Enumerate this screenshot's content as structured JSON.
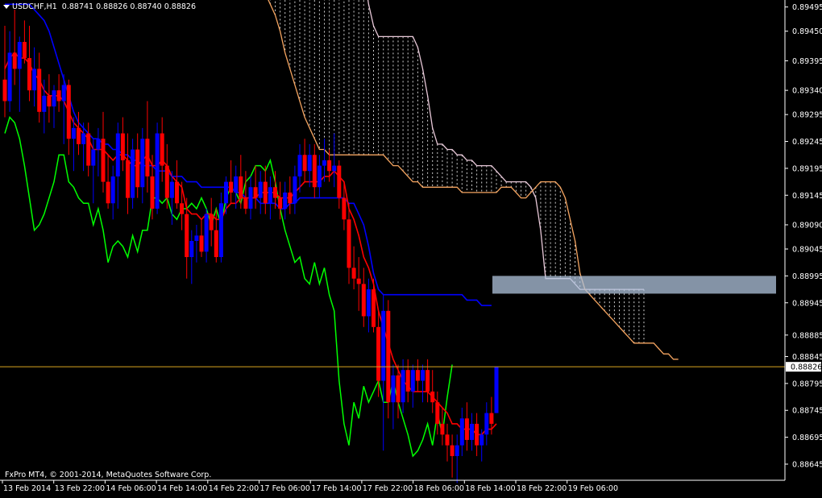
{
  "header": {
    "symbol_timeframe": "USDCHF,H1",
    "ohlc": "0.88741 0.88826 0.88740 0.88826"
  },
  "copyright": "FxPro MT4, © 2001-2014, MetaQuotes Software Corp.",
  "colors": {
    "background": "#000000",
    "bull_candle": "#0000FF",
    "bear_candle": "#FF0000",
    "tenkan": "#FF0000",
    "kijun": "#0000FF",
    "chikou": "#00FF00",
    "senkou_a": "#F4A460",
    "senkou_b": "#E8C8D8",
    "price_line": "#DAA520",
    "zone": "#B0C4DE"
  },
  "chart_data": {
    "type": "candlestick",
    "symbol": "USDCHF",
    "timeframe": "H1",
    "indicator": "Ichimoku Kinko Hyo",
    "last_price": "0.88826",
    "ylim": [
      0.88615,
      0.89505
    ],
    "y_ticks": [
      "0.89495",
      "0.89450",
      "0.89395",
      "0.89340",
      "0.89295",
      "0.89245",
      "0.89195",
      "0.89145",
      "0.89090",
      "0.89045",
      "0.88995",
      "0.88945",
      "0.88885",
      "0.88845",
      "0.88795",
      "0.88745",
      "0.88695",
      "0.88645"
    ],
    "x_labels": [
      "13 Feb 2014",
      "13 Feb 22:00",
      "14 Feb 06:00",
      "14 Feb 14:00",
      "14 Feb 22:00",
      "17 Feb 06:00",
      "17 Feb 14:00",
      "17 Feb 22:00",
      "18 Feb 06:00",
      "18 Feb 14:00",
      "18 Feb 22:00",
      "19 Feb 06:00"
    ],
    "candles": [
      {
        "o": 0.8936,
        "h": 0.8946,
        "l": 0.8929,
        "c": 0.8932
      },
      {
        "o": 0.8932,
        "h": 0.8945,
        "l": 0.893,
        "c": 0.8941
      },
      {
        "o": 0.8941,
        "h": 0.8949,
        "l": 0.8935,
        "c": 0.8938
      },
      {
        "o": 0.8938,
        "h": 0.8944,
        "l": 0.893,
        "c": 0.8943
      },
      {
        "o": 0.8943,
        "h": 0.8947,
        "l": 0.8939,
        "c": 0.894
      },
      {
        "o": 0.894,
        "h": 0.8946,
        "l": 0.8932,
        "c": 0.8934
      },
      {
        "o": 0.8934,
        "h": 0.8942,
        "l": 0.8931,
        "c": 0.8938
      },
      {
        "o": 0.8938,
        "h": 0.8941,
        "l": 0.8928,
        "c": 0.893
      },
      {
        "o": 0.893,
        "h": 0.8936,
        "l": 0.8926,
        "c": 0.8933
      },
      {
        "o": 0.8933,
        "h": 0.8937,
        "l": 0.8928,
        "c": 0.8931
      },
      {
        "o": 0.8931,
        "h": 0.8935,
        "l": 0.8927,
        "c": 0.8934
      },
      {
        "o": 0.8934,
        "h": 0.8937,
        "l": 0.893,
        "c": 0.8932
      },
      {
        "o": 0.8932,
        "h": 0.8937,
        "l": 0.8924,
        "c": 0.8935
      },
      {
        "o": 0.8935,
        "h": 0.8936,
        "l": 0.8922,
        "c": 0.8925
      },
      {
        "o": 0.8925,
        "h": 0.8929,
        "l": 0.8919,
        "c": 0.8927
      },
      {
        "o": 0.8927,
        "h": 0.893,
        "l": 0.8922,
        "c": 0.8924
      },
      {
        "o": 0.8924,
        "h": 0.8928,
        "l": 0.8919,
        "c": 0.8926
      },
      {
        "o": 0.8926,
        "h": 0.8928,
        "l": 0.8918,
        "c": 0.892
      },
      {
        "o": 0.892,
        "h": 0.8925,
        "l": 0.8913,
        "c": 0.8923
      },
      {
        "o": 0.8923,
        "h": 0.8927,
        "l": 0.8918,
        "c": 0.8925
      },
      {
        "o": 0.8925,
        "h": 0.893,
        "l": 0.8915,
        "c": 0.8917
      },
      {
        "o": 0.8917,
        "h": 0.8922,
        "l": 0.8912,
        "c": 0.8913
      },
      {
        "o": 0.8913,
        "h": 0.892,
        "l": 0.891,
        "c": 0.8918
      },
      {
        "o": 0.8918,
        "h": 0.8928,
        "l": 0.8912,
        "c": 0.8926
      },
      {
        "o": 0.8926,
        "h": 0.8929,
        "l": 0.8919,
        "c": 0.8921
      },
      {
        "o": 0.8921,
        "h": 0.8926,
        "l": 0.8911,
        "c": 0.8914
      },
      {
        "o": 0.8914,
        "h": 0.8925,
        "l": 0.8912,
        "c": 0.8923
      },
      {
        "o": 0.8923,
        "h": 0.8926,
        "l": 0.8914,
        "c": 0.8916
      },
      {
        "o": 0.8916,
        "h": 0.8927,
        "l": 0.8913,
        "c": 0.8925
      },
      {
        "o": 0.8925,
        "h": 0.8932,
        "l": 0.8915,
        "c": 0.8918
      },
      {
        "o": 0.8918,
        "h": 0.8922,
        "l": 0.891,
        "c": 0.8912
      },
      {
        "o": 0.8912,
        "h": 0.8928,
        "l": 0.8911,
        "c": 0.8926
      },
      {
        "o": 0.8926,
        "h": 0.8929,
        "l": 0.8917,
        "c": 0.892
      },
      {
        "o": 0.892,
        "h": 0.8924,
        "l": 0.8912,
        "c": 0.8914
      },
      {
        "o": 0.8914,
        "h": 0.8919,
        "l": 0.8909,
        "c": 0.8917
      },
      {
        "o": 0.8917,
        "h": 0.8921,
        "l": 0.8912,
        "c": 0.8913
      },
      {
        "o": 0.8913,
        "h": 0.8917,
        "l": 0.8908,
        "c": 0.8911
      },
      {
        "o": 0.8911,
        "h": 0.8914,
        "l": 0.8899,
        "c": 0.8903
      },
      {
        "o": 0.8903,
        "h": 0.8908,
        "l": 0.8898,
        "c": 0.8906
      },
      {
        "o": 0.8906,
        "h": 0.8909,
        "l": 0.8902,
        "c": 0.8907
      },
      {
        "o": 0.8907,
        "h": 0.891,
        "l": 0.8903,
        "c": 0.8904
      },
      {
        "o": 0.8904,
        "h": 0.8912,
        "l": 0.8902,
        "c": 0.8911
      },
      {
        "o": 0.8911,
        "h": 0.8914,
        "l": 0.8905,
        "c": 0.8908
      },
      {
        "o": 0.8908,
        "h": 0.8912,
        "l": 0.8902,
        "c": 0.8903
      },
      {
        "o": 0.8903,
        "h": 0.8915,
        "l": 0.8902,
        "c": 0.8913
      },
      {
        "o": 0.8913,
        "h": 0.8918,
        "l": 0.8911,
        "c": 0.8917
      },
      {
        "o": 0.8917,
        "h": 0.8921,
        "l": 0.8913,
        "c": 0.8915
      },
      {
        "o": 0.8915,
        "h": 0.892,
        "l": 0.8912,
        "c": 0.8918
      },
      {
        "o": 0.8918,
        "h": 0.8922,
        "l": 0.8912,
        "c": 0.8914
      },
      {
        "o": 0.8914,
        "h": 0.8919,
        "l": 0.8911,
        "c": 0.8912
      },
      {
        "o": 0.8912,
        "h": 0.8918,
        "l": 0.891,
        "c": 0.8916
      },
      {
        "o": 0.8916,
        "h": 0.892,
        "l": 0.8912,
        "c": 0.8914
      },
      {
        "o": 0.8914,
        "h": 0.8919,
        "l": 0.8911,
        "c": 0.8917
      },
      {
        "o": 0.8917,
        "h": 0.892,
        "l": 0.8911,
        "c": 0.8913
      },
      {
        "o": 0.8913,
        "h": 0.8918,
        "l": 0.891,
        "c": 0.8916
      },
      {
        "o": 0.8916,
        "h": 0.8919,
        "l": 0.8912,
        "c": 0.8914
      },
      {
        "o": 0.8914,
        "h": 0.8917,
        "l": 0.891,
        "c": 0.8912
      },
      {
        "o": 0.8912,
        "h": 0.8917,
        "l": 0.891,
        "c": 0.8915
      },
      {
        "o": 0.8915,
        "h": 0.8918,
        "l": 0.8911,
        "c": 0.8913
      },
      {
        "o": 0.8913,
        "h": 0.892,
        "l": 0.8911,
        "c": 0.8918
      },
      {
        "o": 0.8918,
        "h": 0.8924,
        "l": 0.8915,
        "c": 0.8922
      },
      {
        "o": 0.8922,
        "h": 0.8925,
        "l": 0.8917,
        "c": 0.8919
      },
      {
        "o": 0.8919,
        "h": 0.8924,
        "l": 0.8916,
        "c": 0.8922
      },
      {
        "o": 0.8922,
        "h": 0.8924,
        "l": 0.8914,
        "c": 0.8916
      },
      {
        "o": 0.8916,
        "h": 0.8922,
        "l": 0.8914,
        "c": 0.892
      },
      {
        "o": 0.892,
        "h": 0.8925,
        "l": 0.8917,
        "c": 0.8921
      },
      {
        "o": 0.8921,
        "h": 0.8923,
        "l": 0.8917,
        "c": 0.8919
      },
      {
        "o": 0.8919,
        "h": 0.8926,
        "l": 0.8916,
        "c": 0.892
      },
      {
        "o": 0.892,
        "h": 0.8921,
        "l": 0.8912,
        "c": 0.8914
      },
      {
        "o": 0.8914,
        "h": 0.8917,
        "l": 0.8908,
        "c": 0.891
      },
      {
        "o": 0.891,
        "h": 0.8913,
        "l": 0.8898,
        "c": 0.8901
      },
      {
        "o": 0.8901,
        "h": 0.8905,
        "l": 0.8897,
        "c": 0.8899
      },
      {
        "o": 0.8899,
        "h": 0.8903,
        "l": 0.8893,
        "c": 0.8898
      },
      {
        "o": 0.8898,
        "h": 0.8901,
        "l": 0.889,
        "c": 0.8892
      },
      {
        "o": 0.8892,
        "h": 0.8899,
        "l": 0.8889,
        "c": 0.8897
      },
      {
        "o": 0.8897,
        "h": 0.8899,
        "l": 0.8889,
        "c": 0.889
      },
      {
        "o": 0.889,
        "h": 0.8893,
        "l": 0.8877,
        "c": 0.888
      },
      {
        "o": 0.888,
        "h": 0.8896,
        "l": 0.8867,
        "c": 0.8893
      },
      {
        "o": 0.8893,
        "h": 0.8895,
        "l": 0.8873,
        "c": 0.8876
      },
      {
        "o": 0.8876,
        "h": 0.8883,
        "l": 0.8871,
        "c": 0.8881
      },
      {
        "o": 0.8881,
        "h": 0.8883,
        "l": 0.8873,
        "c": 0.8876
      },
      {
        "o": 0.8876,
        "h": 0.8884,
        "l": 0.8874,
        "c": 0.8882
      },
      {
        "o": 0.8882,
        "h": 0.8884,
        "l": 0.8876,
        "c": 0.8878
      },
      {
        "o": 0.8878,
        "h": 0.8883,
        "l": 0.8875,
        "c": 0.8882
      },
      {
        "o": 0.8882,
        "h": 0.8884,
        "l": 0.8878,
        "c": 0.888
      },
      {
        "o": 0.888,
        "h": 0.8883,
        "l": 0.8876,
        "c": 0.8882
      },
      {
        "o": 0.8882,
        "h": 0.8884,
        "l": 0.8876,
        "c": 0.8878
      },
      {
        "o": 0.8878,
        "h": 0.8882,
        "l": 0.8874,
        "c": 0.8876
      },
      {
        "o": 0.8876,
        "h": 0.8878,
        "l": 0.887,
        "c": 0.8872
      },
      {
        "o": 0.8872,
        "h": 0.8875,
        "l": 0.8868,
        "c": 0.887
      },
      {
        "o": 0.887,
        "h": 0.8872,
        "l": 0.8865,
        "c": 0.8868
      },
      {
        "o": 0.8868,
        "h": 0.887,
        "l": 0.8862,
        "c": 0.8866
      },
      {
        "o": 0.8866,
        "h": 0.887,
        "l": 0.8861,
        "c": 0.8868
      },
      {
        "o": 0.8868,
        "h": 0.8875,
        "l": 0.8866,
        "c": 0.8873
      },
      {
        "o": 0.8873,
        "h": 0.8876,
        "l": 0.8867,
        "c": 0.8869
      },
      {
        "o": 0.8869,
        "h": 0.8874,
        "l": 0.8867,
        "c": 0.8872
      },
      {
        "o": 0.8872,
        "h": 0.8874,
        "l": 0.8866,
        "c": 0.8868
      },
      {
        "o": 0.8868,
        "h": 0.8871,
        "l": 0.8865,
        "c": 0.887
      },
      {
        "o": 0.887,
        "h": 0.8876,
        "l": 0.8868,
        "c": 0.8874
      },
      {
        "o": 0.8874,
        "h": 0.8877,
        "l": 0.887,
        "c": 0.8872
      },
      {
        "o": 0.8874,
        "h": 0.88826,
        "l": 0.8874,
        "c": 0.88826
      }
    ],
    "tenkan": [
      0.8938,
      0.894,
      0.8941,
      0.894,
      0.894,
      0.8939,
      0.8937,
      0.8936,
      0.8934,
      0.8933,
      0.8933,
      0.8933,
      0.8932,
      0.893,
      0.8928,
      0.8927,
      0.8926,
      0.8925,
      0.8923,
      0.8923,
      0.8923,
      0.8922,
      0.8921,
      0.8922,
      0.8922,
      0.8921,
      0.892,
      0.892,
      0.8921,
      0.8922,
      0.892,
      0.892,
      0.8921,
      0.892,
      0.8918,
      0.8917,
      0.8916,
      0.8912,
      0.8911,
      0.8911,
      0.891,
      0.8911,
      0.8911,
      0.891,
      0.891,
      0.8912,
      0.8913,
      0.8913,
      0.8914,
      0.8914,
      0.8914,
      0.8914,
      0.8915,
      0.8915,
      0.8915,
      0.8915,
      0.8914,
      0.8914,
      0.8914,
      0.8915,
      0.8916,
      0.8917,
      0.8917,
      0.8917,
      0.8917,
      0.8918,
      0.8918,
      0.8919,
      0.8918,
      0.8917,
      0.8912,
      0.891,
      0.8907,
      0.8903,
      0.8901,
      0.8898,
      0.8893,
      0.889,
      0.8887,
      0.8884,
      0.8882,
      0.888,
      0.8879,
      0.8878,
      0.8878,
      0.8878,
      0.8878,
      0.8877,
      0.8876,
      0.8875,
      0.8874,
      0.8872,
      0.8872,
      0.8871,
      0.8871,
      0.8871,
      0.887,
      0.887,
      0.8871,
      0.8871,
      0.8872
    ],
    "kijun": [
      0.895,
      0.895,
      0.895,
      0.895,
      0.895,
      0.895,
      0.8949,
      0.8948,
      0.8947,
      0.8945,
      0.8942,
      0.8939,
      0.8936,
      0.8933,
      0.893,
      0.8928,
      0.8927,
      0.8926,
      0.8925,
      0.8925,
      0.8924,
      0.8924,
      0.8923,
      0.8923,
      0.8922,
      0.8922,
      0.8921,
      0.8921,
      0.892,
      0.892,
      0.892,
      0.8919,
      0.8919,
      0.8919,
      0.8918,
      0.8918,
      0.8918,
      0.8917,
      0.8917,
      0.8917,
      0.8916,
      0.8916,
      0.8916,
      0.8916,
      0.8916,
      0.8916,
      0.8916,
      0.8915,
      0.8915,
      0.8914,
      0.8914,
      0.8914,
      0.8913,
      0.8913,
      0.8913,
      0.8913,
      0.8912,
      0.8912,
      0.8913,
      0.8913,
      0.8914,
      0.8914,
      0.8914,
      0.8914,
      0.8914,
      0.8914,
      0.8914,
      0.8914,
      0.8914,
      0.8914,
      0.8913,
      0.8913,
      0.8911,
      0.8909,
      0.8905,
      0.89,
      0.8897,
      0.8896,
      0.8896,
      0.8896,
      0.8896,
      0.8896,
      0.8896,
      0.8896,
      0.8896,
      0.8896,
      0.8896,
      0.8896,
      0.8896,
      0.8896,
      0.8896,
      0.8896,
      0.8896,
      0.8896,
      0.8895,
      0.8895,
      0.8895,
      0.8894,
      0.8894,
      0.8894
    ],
    "chikou": [
      0.8926,
      0.8929,
      0.8928,
      0.8925,
      0.892,
      0.8914,
      0.8908,
      0.8909,
      0.8911,
      0.8914,
      0.8917,
      0.8922,
      0.8922,
      0.8917,
      0.8916,
      0.8914,
      0.8913,
      0.8913,
      0.8909,
      0.8912,
      0.8908,
      0.8902,
      0.8905,
      0.8906,
      0.8905,
      0.8903,
      0.8907,
      0.8904,
      0.8908,
      0.8908,
      0.8914,
      0.8914,
      0.8913,
      0.8914,
      0.8911,
      0.891,
      0.8912,
      0.8912,
      0.8913,
      0.8912,
      0.8914,
      0.8912,
      0.8909,
      0.8912,
      0.8909,
      0.8914,
      0.8916,
      0.8915,
      0.8913,
      0.8917,
      0.8918,
      0.892,
      0.892,
      0.8919,
      0.8921,
      0.8917,
      0.8912,
      0.8908,
      0.8905,
      0.8902,
      0.8903,
      0.8899,
      0.8898,
      0.8902,
      0.8898,
      0.8901,
      0.8896,
      0.8893,
      0.888,
      0.8872,
      0.8868,
      0.8876,
      0.8873,
      0.8879,
      0.8876,
      0.8878,
      0.888,
      0.8876,
      0.8876,
      0.888,
      0.8876,
      0.8873,
      0.887,
      0.8866,
      0.8867,
      0.8869,
      0.8872,
      0.8868,
      0.8874,
      0.887,
      0.8877,
      0.8883
    ],
    "senkou_a": [
      0.8975,
      0.8972,
      0.897,
      0.8968,
      0.8966,
      0.8964,
      0.8962,
      0.896,
      0.8958,
      0.8956,
      0.8955,
      0.8954,
      0.8952,
      0.895,
      0.8948,
      0.8945,
      0.8941,
      0.8938,
      0.8935,
      0.8932,
      0.8929,
      0.8927,
      0.8925,
      0.8923,
      0.8923,
      0.8922,
      0.8922,
      0.8922,
      0.8922,
      0.8922,
      0.8922,
      0.8922,
      0.8922,
      0.8922,
      0.8922,
      0.8922,
      0.8922,
      0.8921,
      0.892,
      0.892,
      0.8919,
      0.8918,
      0.8917,
      0.8917,
      0.8916,
      0.8916,
      0.8916,
      0.8916,
      0.8916,
      0.8916,
      0.8916,
      0.8916,
      0.8915,
      0.8915,
      0.8915,
      0.8915,
      0.8915,
      0.8915,
      0.8915,
      0.8915,
      0.8916,
      0.8916,
      0.8916,
      0.8915,
      0.8914,
      0.8914,
      0.8915,
      0.8916,
      0.8917,
      0.8917,
      0.8917,
      0.8917,
      0.8916,
      0.8914,
      0.891,
      0.8906,
      0.89,
      0.8897,
      0.8896,
      0.8895,
      0.8894,
      0.8893,
      0.8892,
      0.8891,
      0.889,
      0.8889,
      0.8888,
      0.8887,
      0.8887,
      0.8887,
      0.8887,
      0.8887,
      0.8886,
      0.8885,
      0.8885,
      0.8884,
      0.8884
    ],
    "senkou_b": [
      0.8998,
      0.8998,
      0.8998,
      0.8998,
      0.8998,
      0.8998,
      0.8998,
      0.8998,
      0.8996,
      0.8994,
      0.8993,
      0.8992,
      0.8991,
      0.899,
      0.8988,
      0.8987,
      0.8986,
      0.8984,
      0.8982,
      0.898,
      0.8979,
      0.8978,
      0.8977,
      0.8976,
      0.8975,
      0.8975,
      0.8974,
      0.8972,
      0.897,
      0.8968,
      0.8966,
      0.8962,
      0.8956,
      0.895,
      0.8946,
      0.8944,
      0.8944,
      0.8944,
      0.8944,
      0.8944,
      0.8944,
      0.8944,
      0.8944,
      0.8942,
      0.8938,
      0.8933,
      0.8927,
      0.8924,
      0.8924,
      0.8923,
      0.8923,
      0.8922,
      0.8922,
      0.8921,
      0.8921,
      0.892,
      0.892,
      0.892,
      0.892,
      0.8919,
      0.8918,
      0.8917,
      0.8917,
      0.8917,
      0.8917,
      0.8917,
      0.8916,
      0.8914,
      0.8908,
      0.8899,
      0.8899,
      0.8899,
      0.8899,
      0.8899,
      0.8899,
      0.8898,
      0.8897,
      0.8897,
      0.8897,
      0.8897,
      0.8897,
      0.8897,
      0.8897,
      0.8897,
      0.8897,
      0.8897,
      0.8897,
      0.8897,
      0.8897,
      0.8897
    ],
    "zone": {
      "y_top": 0.88995,
      "y_bottom": 0.88962
    }
  }
}
